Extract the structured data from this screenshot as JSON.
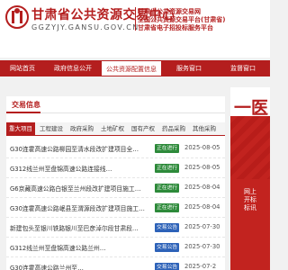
{
  "header": {
    "title": "甘肃省公共资源交易中心",
    "domain": "GGZYJY.GANSU.GOV.CN",
    "sub1": "甘肃省公共资源交易网",
    "sub2": "全国公共资源交易平台(甘肃省)",
    "sub3": "甘肃省电子招投标服务平台"
  },
  "nav": {
    "items": [
      {
        "label": "网站首页",
        "active": false
      },
      {
        "label": "政府信息公开",
        "active": false
      },
      {
        "label": "公共资源配置信息",
        "active": true
      },
      {
        "label": "服务窗口",
        "active": false
      },
      {
        "label": "监督窗口",
        "active": false
      }
    ]
  },
  "panel": {
    "title": "交易信息",
    "tabs": [
      "重大项目",
      "工程建设",
      "政府采购",
      "土地矿权",
      "国有产权",
      "药品采购",
      "其他采购"
    ],
    "active_tab": "重大项目",
    "rows": [
      {
        "title": "G30连霍高速公路柳园至清水段改扩建项目全…",
        "badge": "正在进行",
        "badge_type": "ing",
        "date": "2025-08-05"
      },
      {
        "title": "G312线兰州至盘锦高速公路连接线…",
        "badge": "正在进行",
        "badge_type": "ing",
        "date": "2025-08-05"
      },
      {
        "title": "G6京藏高速公路白银至兰州段改扩建项目施工…",
        "badge": "正在进行",
        "badge_type": "ing",
        "date": "2025-08-04"
      },
      {
        "title": "G30连霍高速公路岷县至渭源段改扩建项目施工监…",
        "badge": "正在进行",
        "badge_type": "ing",
        "date": "2025-08-04"
      },
      {
        "title": "新建包头至银川铁路银川至巴彦淖尔段甘肃段…",
        "badge": "交易公告",
        "badge_type": "notice",
        "date": "2025-07-30"
      },
      {
        "title": "G312线兰州至盘锦高速公路兰州…",
        "badge": "交易公告",
        "badge_type": "notice",
        "date": "2025-07-30"
      },
      {
        "title": "G30连霍高速公路兰州至…",
        "badge": "交易公告",
        "badge_type": "notice",
        "date": "2025-07-2"
      }
    ]
  },
  "banner": {
    "big": "一医",
    "vertical": "网上开标标讯"
  },
  "colors": {
    "brand": "#b41e1e",
    "ing": "#2d8a3a",
    "notice": "#2d62b8"
  }
}
